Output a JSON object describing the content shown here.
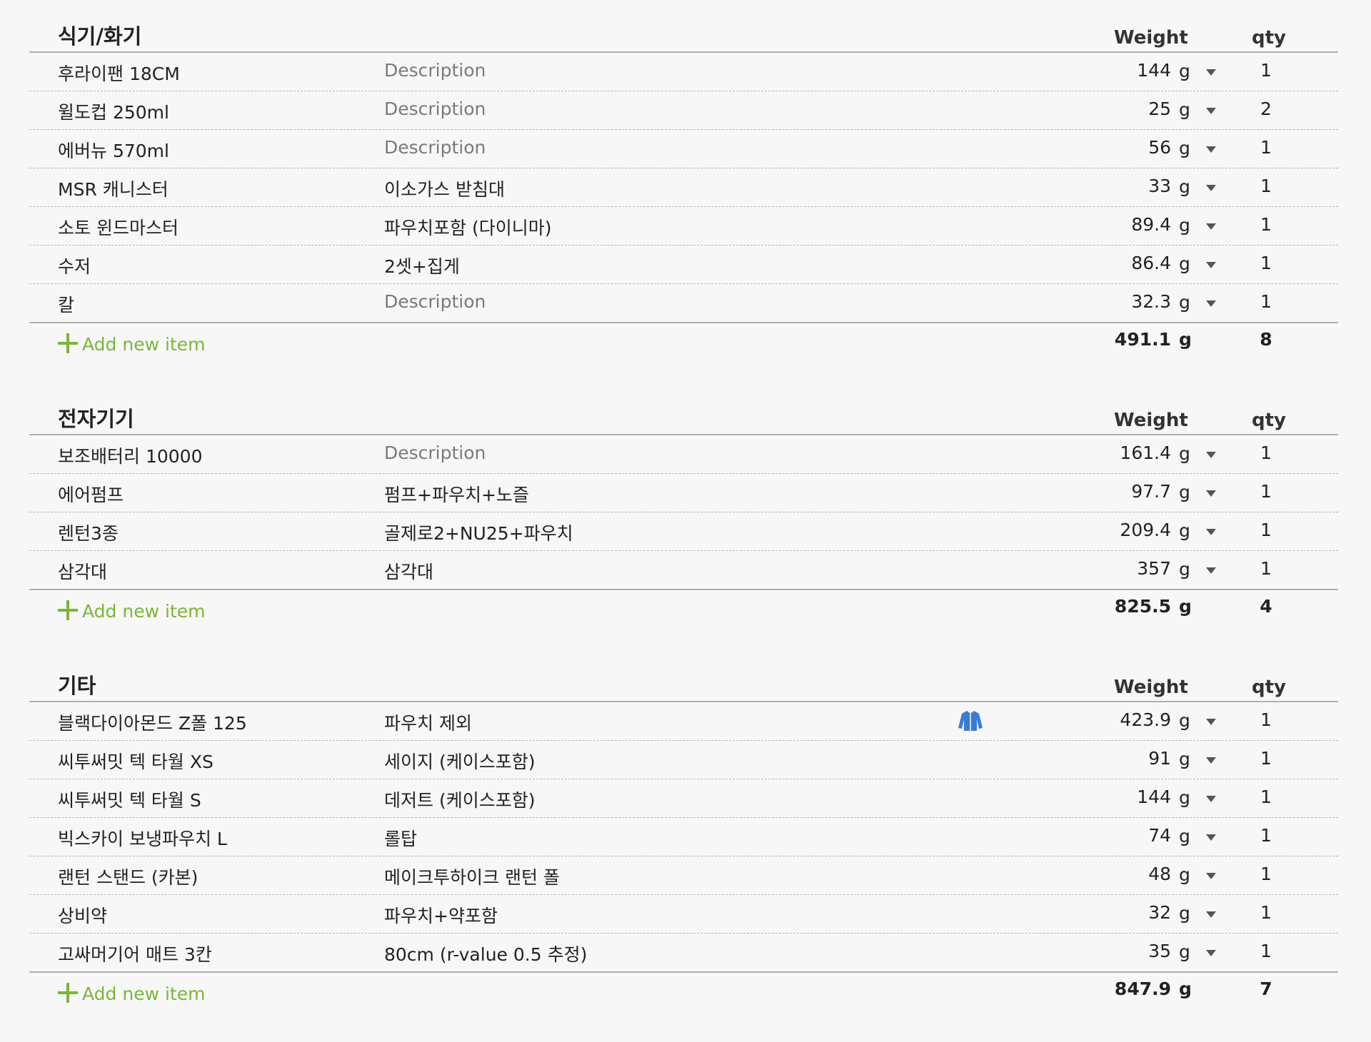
{
  "categories": [
    {
      "title": "식기/화기",
      "weight_header": "Weight",
      "qty_header": "qty",
      "items": [
        {
          "name": "후라이팬 18CM",
          "description": "Description",
          "placeholder": true,
          "weight": "144",
          "unit": "g",
          "qty": "1"
        },
        {
          "name": "윌도컵 250ml",
          "description": "Description",
          "placeholder": true,
          "weight": "25",
          "unit": "g",
          "qty": "2"
        },
        {
          "name": "에버뉴 570ml",
          "description": "Description",
          "placeholder": true,
          "weight": "56",
          "unit": "g",
          "qty": "1"
        },
        {
          "name": "MSR 캐니스터",
          "description": "이소가스 받침대",
          "placeholder": false,
          "weight": "33",
          "unit": "g",
          "qty": "1"
        },
        {
          "name": "소토 윈드마스터",
          "description": "파우치포함 (다이니마)",
          "placeholder": false,
          "weight": "89.4",
          "unit": "g",
          "qty": "1"
        },
        {
          "name": "수저",
          "description": "2셋+집게",
          "placeholder": false,
          "weight": "86.4",
          "unit": "g",
          "qty": "1"
        },
        {
          "name": "칼",
          "description": "Description",
          "placeholder": true,
          "weight": "32.3",
          "unit": "g",
          "qty": "1"
        }
      ],
      "add_label": "Add new item",
      "total_weight": "491.1",
      "total_unit": "g",
      "total_qty": "8"
    },
    {
      "title": "전자기기",
      "weight_header": "Weight",
      "qty_header": "qty",
      "items": [
        {
          "name": "보조배터리 10000",
          "description": "Description",
          "placeholder": true,
          "weight": "161.4",
          "unit": "g",
          "qty": "1"
        },
        {
          "name": "에어펌프",
          "description": "펌프+파우치+노즐",
          "placeholder": false,
          "weight": "97.7",
          "unit": "g",
          "qty": "1"
        },
        {
          "name": "렌턴3종",
          "description": "골제로2+NU25+파우치",
          "placeholder": false,
          "weight": "209.4",
          "unit": "g",
          "qty": "1"
        },
        {
          "name": "삼각대",
          "description": "삼각대",
          "placeholder": false,
          "weight": "357",
          "unit": "g",
          "qty": "1"
        }
      ],
      "add_label": "Add new item",
      "total_weight": "825.5",
      "total_unit": "g",
      "total_qty": "4"
    },
    {
      "title": "기타",
      "weight_header": "Weight",
      "qty_header": "qty",
      "items": [
        {
          "name": "블랙다이아몬드 Z폴 125",
          "description": "파우치 제외",
          "placeholder": false,
          "weight": "423.9",
          "unit": "g",
          "qty": "1",
          "icon": "jacket-icon",
          "icon_color": "#3a7bd5"
        },
        {
          "name": "씨투써밋 텍 타월 XS",
          "description": "세이지 (케이스포함)",
          "placeholder": false,
          "weight": "91",
          "unit": "g",
          "qty": "1"
        },
        {
          "name": "씨투써밋 텍 타월 S",
          "description": "데저트 (케이스포함)",
          "placeholder": false,
          "weight": "144",
          "unit": "g",
          "qty": "1"
        },
        {
          "name": "빅스카이 보냉파우치 L",
          "description": "롤탑",
          "placeholder": false,
          "weight": "74",
          "unit": "g",
          "qty": "1"
        },
        {
          "name": "랜턴 스탠드 (카본)",
          "description": "메이크투하이크 랜턴 폴",
          "placeholder": false,
          "weight": "48",
          "unit": "g",
          "qty": "1"
        },
        {
          "name": "상비약",
          "description": "파우치+약포함",
          "placeholder": false,
          "weight": "32",
          "unit": "g",
          "qty": "1"
        },
        {
          "name": "고싸머기어 매트 3칸",
          "description": "80cm (r-value 0.5 추정)",
          "placeholder": false,
          "weight": "35",
          "unit": "g",
          "qty": "1"
        }
      ],
      "add_label": "Add new item",
      "total_weight": "847.9",
      "total_unit": "g",
      "total_qty": "7"
    }
  ],
  "colors": {
    "accent_green": "#7cb53a",
    "jacket_icon_blue": "#3a7bd5",
    "placeholder_text": "#7a7a7a"
  }
}
